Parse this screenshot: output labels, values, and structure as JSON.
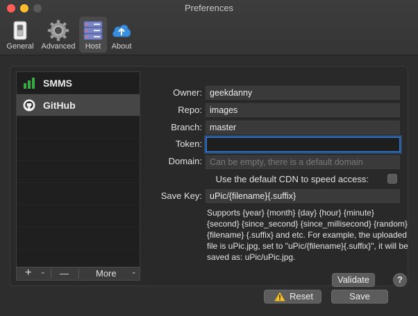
{
  "window": {
    "title": "Preferences"
  },
  "toolbar": {
    "items": [
      {
        "label": "General",
        "icon": "switch-icon"
      },
      {
        "label": "Advanced",
        "icon": "gear-icon"
      },
      {
        "label": "Host",
        "icon": "server-icon",
        "active": true
      },
      {
        "label": "About",
        "icon": "cloud-upload-icon"
      }
    ]
  },
  "hosts": {
    "items": [
      {
        "name": "SMMS",
        "icon": "signal-bars-icon"
      },
      {
        "name": "GitHub",
        "icon": "github-icon",
        "selected": true
      }
    ],
    "add_label": "+",
    "remove_label": "—",
    "more_label": "More"
  },
  "form": {
    "owner": {
      "label": "Owner:",
      "value": "geekdanny"
    },
    "repo": {
      "label": "Repo:",
      "value": "images"
    },
    "branch": {
      "label": "Branch:",
      "value": "master"
    },
    "token": {
      "label": "Token:",
      "value": ""
    },
    "domain": {
      "label": "Domain:",
      "placeholder": "Can be empty, there is a default domain"
    },
    "cdn": {
      "label": "Use the default CDN to speed access:",
      "checked": false
    },
    "savekey": {
      "label": "Save Key:",
      "value": "uPic/{filename}{.suffix}"
    },
    "description": "Supports {year} {month} {day} {hour} {minute} {second} {since_second} {since_millisecond} {random} {filename} {.suffix} and etc. For example, the uploaded file is uPic.jpg, set to \"uPic/{filename}{.suffix}\", it will be saved as: uPic/uPic.jpg."
  },
  "buttons": {
    "validate": "Validate",
    "help": "?",
    "reset": "Reset",
    "save": "Save"
  },
  "colors": {
    "accent": "#2d6fbe",
    "warning": "#f2c12e",
    "smms_green": "#3aa845"
  }
}
